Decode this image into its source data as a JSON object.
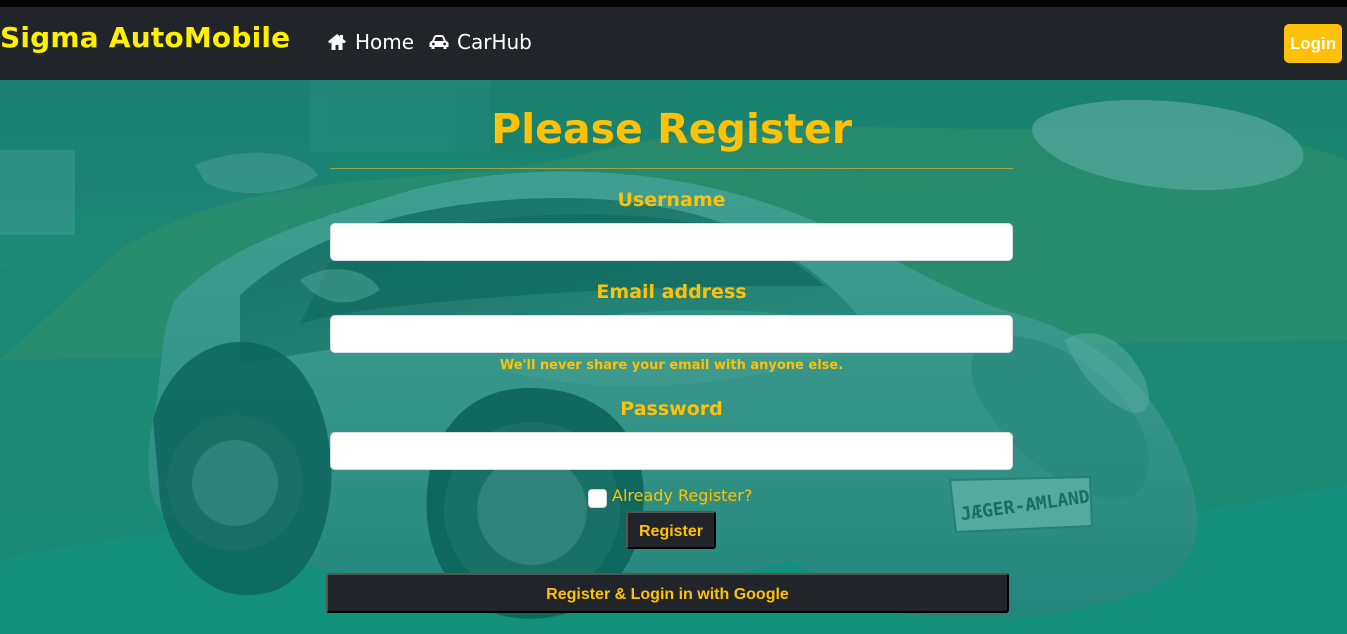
{
  "app": {
    "brand": "Sigma AutoMobile"
  },
  "nav": {
    "items": [
      {
        "label": "Home",
        "icon": "home-icon"
      },
      {
        "label": "CarHub",
        "icon": "car-icon"
      }
    ],
    "login_label": "Login"
  },
  "hero": {
    "title": "Please Register",
    "license_plate": "JÆGER-AMLAND"
  },
  "form": {
    "username": {
      "label": "Username",
      "value": "",
      "placeholder": ""
    },
    "email": {
      "label": "Email address",
      "value": "",
      "placeholder": "",
      "help_text": "We'll never share your email with anyone else."
    },
    "password": {
      "label": "Password",
      "value": "",
      "placeholder": ""
    },
    "already_register_label": "Already Register?",
    "already_register_checked": false,
    "register_button": "Register",
    "google_button": "Register & Login in with Google"
  },
  "colors": {
    "navbar": "#212529",
    "brand": "#ffef00",
    "accent": "#ffc107",
    "nav_text": "#ffffff",
    "overlay": "#009b85"
  }
}
